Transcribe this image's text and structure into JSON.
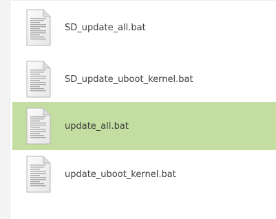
{
  "colors": {
    "selection": "#c3dea0",
    "text": "#3c3c3c"
  },
  "icon": "text-document-icon",
  "files": [
    {
      "name": "SD_update_all.bat",
      "selected": false
    },
    {
      "name": "SD_update_uboot_kernel.bat",
      "selected": false
    },
    {
      "name": "update_all.bat",
      "selected": true
    },
    {
      "name": "update_uboot_kernel.bat",
      "selected": false
    }
  ]
}
